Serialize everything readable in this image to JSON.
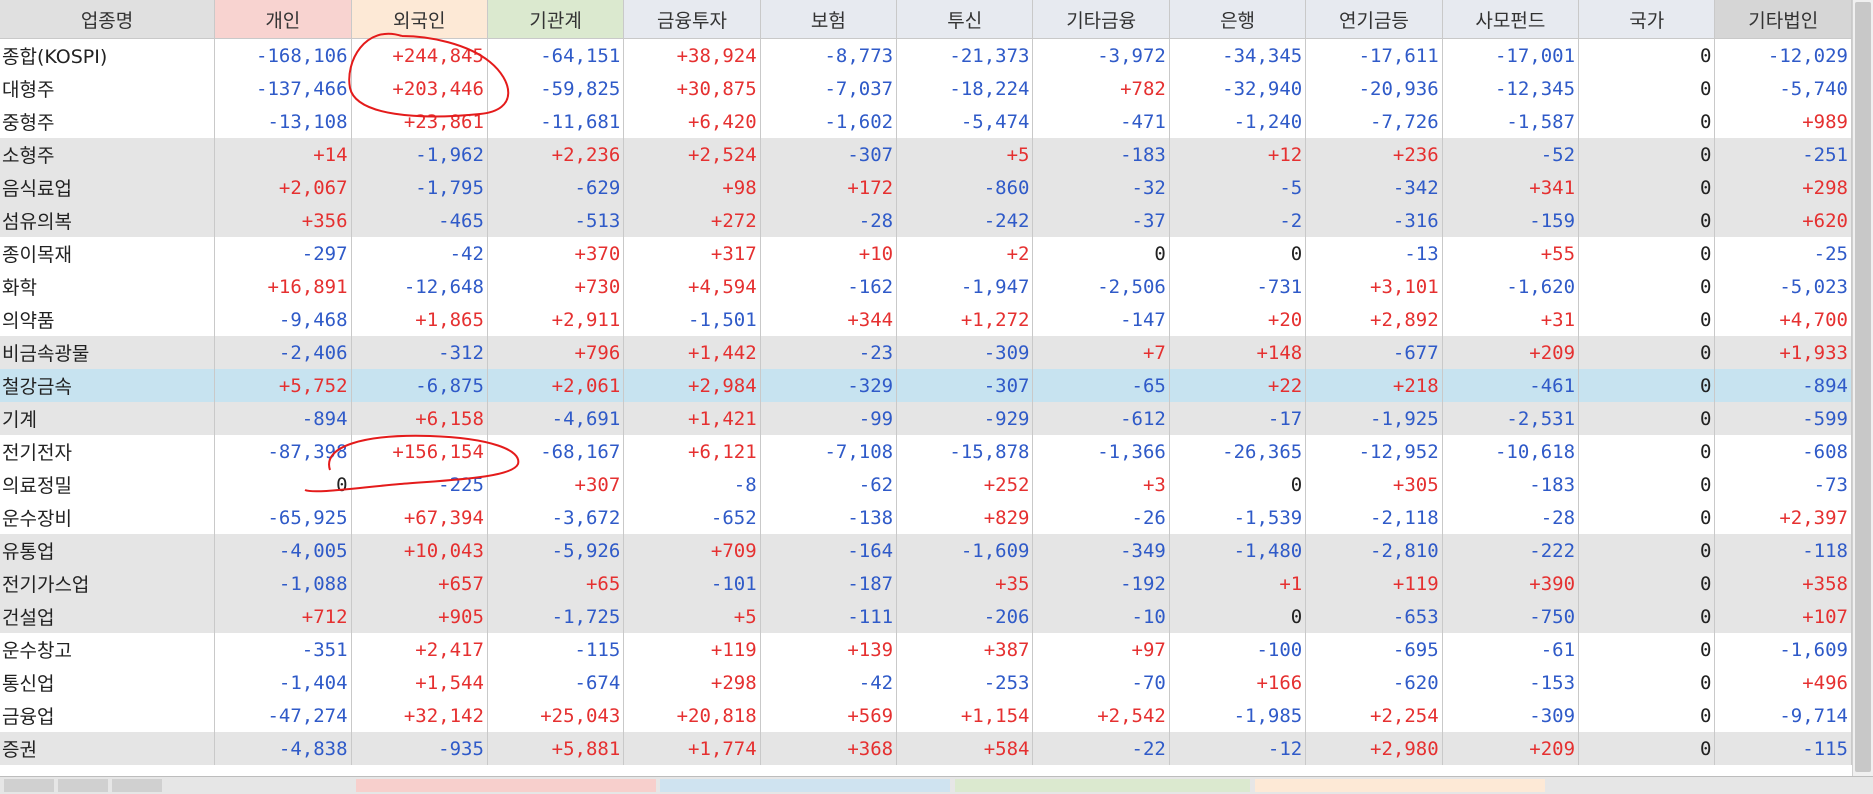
{
  "headers": [
    "업종명",
    "개인",
    "외국인",
    "기관계",
    "금융투자",
    "보험",
    "투신",
    "기타금융",
    "은행",
    "연기금등",
    "사모펀드",
    "국가",
    "기타법인"
  ],
  "rows": [
    {
      "name": "종합(KOSPI)",
      "shade": "white",
      "values": [
        "-168,106",
        "+244,845",
        "-64,151",
        "+38,924",
        "-8,773",
        "-21,373",
        "-3,972",
        "-34,345",
        "-17,611",
        "-17,001",
        "0",
        "-12,029"
      ]
    },
    {
      "name": "대형주",
      "shade": "white",
      "values": [
        "-137,466",
        "+203,446",
        "-59,825",
        "+30,875",
        "-7,037",
        "-18,224",
        "+782",
        "-32,940",
        "-20,936",
        "-12,345",
        "0",
        "-5,740"
      ]
    },
    {
      "name": "중형주",
      "shade": "white",
      "values": [
        "-13,108",
        "+23,861",
        "-11,681",
        "+6,420",
        "-1,602",
        "-5,474",
        "-471",
        "-1,240",
        "-7,726",
        "-1,587",
        "0",
        "+989"
      ]
    },
    {
      "name": "소형주",
      "shade": "gray",
      "values": [
        "+14",
        "-1,962",
        "+2,236",
        "+2,524",
        "-307",
        "+5",
        "-183",
        "+12",
        "+236",
        "-52",
        "0",
        "-251"
      ]
    },
    {
      "name": "음식료업",
      "shade": "gray",
      "values": [
        "+2,067",
        "-1,795",
        "-629",
        "+98",
        "+172",
        "-860",
        "-32",
        "-5",
        "-342",
        "+341",
        "0",
        "+298"
      ]
    },
    {
      "name": "섬유의복",
      "shade": "gray",
      "values": [
        "+356",
        "-465",
        "-513",
        "+272",
        "-28",
        "-242",
        "-37",
        "-2",
        "-316",
        "-159",
        "0",
        "+620"
      ]
    },
    {
      "name": "종이목재",
      "shade": "white",
      "values": [
        "-297",
        "-42",
        "+370",
        "+317",
        "+10",
        "+2",
        "0",
        "0",
        "-13",
        "+55",
        "0",
        "-25"
      ]
    },
    {
      "name": "화학",
      "shade": "white",
      "values": [
        "+16,891",
        "-12,648",
        "+730",
        "+4,594",
        "-162",
        "-1,947",
        "-2,506",
        "-731",
        "+3,101",
        "-1,620",
        "0",
        "-5,023"
      ]
    },
    {
      "name": "의약품",
      "shade": "white",
      "values": [
        "-9,468",
        "+1,865",
        "+2,911",
        "-1,501",
        "+344",
        "+1,272",
        "-147",
        "+20",
        "+2,892",
        "+31",
        "0",
        "+4,700"
      ]
    },
    {
      "name": "비금속광물",
      "shade": "gray",
      "values": [
        "-2,406",
        "-312",
        "+796",
        "+1,442",
        "-23",
        "-309",
        "+7",
        "+148",
        "-677",
        "+209",
        "0",
        "+1,933"
      ]
    },
    {
      "name": "철강금속",
      "shade": "blue",
      "values": [
        "+5,752",
        "-6,875",
        "+2,061",
        "+2,984",
        "-329",
        "-307",
        "-65",
        "+22",
        "+218",
        "-461",
        "0",
        "-894"
      ]
    },
    {
      "name": "기계",
      "shade": "gray",
      "values": [
        "-894",
        "+6,158",
        "-4,691",
        "+1,421",
        "-99",
        "-929",
        "-612",
        "-17",
        "-1,925",
        "-2,531",
        "0",
        "-599"
      ]
    },
    {
      "name": "전기전자",
      "shade": "white",
      "values": [
        "-87,398",
        "+156,154",
        "-68,167",
        "+6,121",
        "-7,108",
        "-15,878",
        "-1,366",
        "-26,365",
        "-12,952",
        "-10,618",
        "0",
        "-608"
      ]
    },
    {
      "name": "의료정밀",
      "shade": "white",
      "values": [
        "0",
        "-225",
        "+307",
        "-8",
        "-62",
        "+252",
        "+3",
        "0",
        "+305",
        "-183",
        "0",
        "-73"
      ]
    },
    {
      "name": "운수장비",
      "shade": "white",
      "values": [
        "-65,925",
        "+67,394",
        "-3,672",
        "-652",
        "-138",
        "+829",
        "-26",
        "-1,539",
        "-2,118",
        "-28",
        "0",
        "+2,397"
      ]
    },
    {
      "name": "유통업",
      "shade": "gray",
      "values": [
        "-4,005",
        "+10,043",
        "-5,926",
        "+709",
        "-164",
        "-1,609",
        "-349",
        "-1,480",
        "-2,810",
        "-222",
        "0",
        "-118"
      ]
    },
    {
      "name": "전기가스업",
      "shade": "gray",
      "values": [
        "-1,088",
        "+657",
        "+65",
        "-101",
        "-187",
        "+35",
        "-192",
        "+1",
        "+119",
        "+390",
        "0",
        "+358"
      ]
    },
    {
      "name": "건설업",
      "shade": "gray",
      "values": [
        "+712",
        "+905",
        "-1,725",
        "+5",
        "-111",
        "-206",
        "-10",
        "0",
        "-653",
        "-750",
        "0",
        "+107"
      ]
    },
    {
      "name": "운수창고",
      "shade": "white",
      "values": [
        "-351",
        "+2,417",
        "-115",
        "+119",
        "+139",
        "+387",
        "+97",
        "-100",
        "-695",
        "-61",
        "0",
        "-1,609"
      ]
    },
    {
      "name": "통신업",
      "shade": "white",
      "values": [
        "-1,404",
        "+1,544",
        "-674",
        "+298",
        "-42",
        "-253",
        "-70",
        "+166",
        "-620",
        "-153",
        "0",
        "+496"
      ]
    },
    {
      "name": "금융업",
      "shade": "white",
      "values": [
        "-47,274",
        "+32,142",
        "+25,043",
        "+20,818",
        "+569",
        "+1,154",
        "+2,542",
        "-1,985",
        "+2,254",
        "-309",
        "0",
        "-9,714"
      ]
    },
    {
      "name": "증권",
      "shade": "gray",
      "values": [
        "-4,838",
        "-935",
        "+5,881",
        "+1,774",
        "+368",
        "+584",
        "-22",
        "-12",
        "+2,980",
        "+209",
        "0",
        "-115"
      ]
    }
  ],
  "colors": {
    "positive": "#e53030",
    "negative": "#2f5ac8",
    "annotation": "#e41b1b"
  }
}
